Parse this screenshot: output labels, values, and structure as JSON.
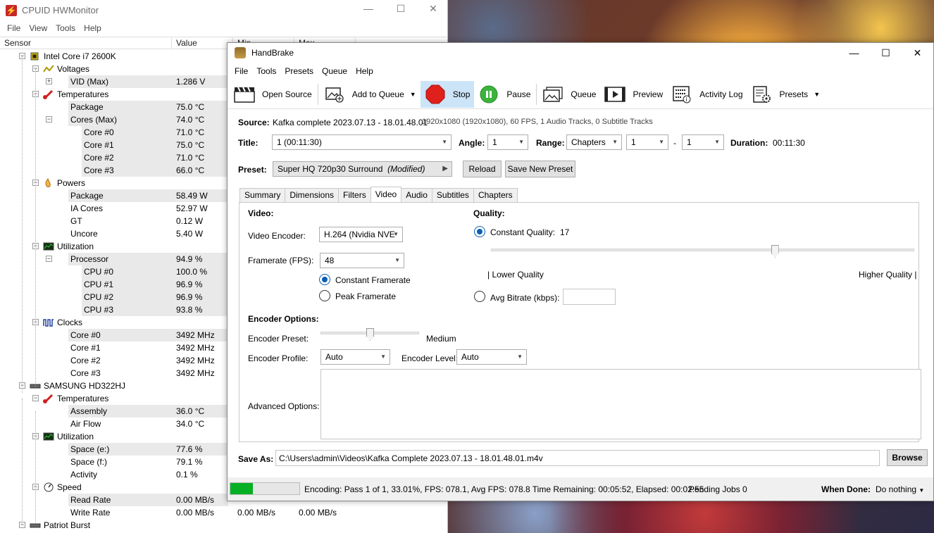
{
  "hwmonitor": {
    "title": "CPUID HWMonitor",
    "menu": [
      "File",
      "View",
      "Tools",
      "Help"
    ],
    "columns": {
      "sensor": "Sensor",
      "value": "Value",
      "min": "Min",
      "max": "Max"
    },
    "rows": [
      {
        "label": "Intel Core i7 2600K",
        "depth": 0,
        "icon": "cpu-chip-icon",
        "expander": "-"
      },
      {
        "label": "Voltages",
        "depth": 1,
        "icon": "voltage-icon",
        "expander": "-"
      },
      {
        "label": "VID (Max)",
        "depth": 2,
        "value": "1.286 V",
        "expander": "+",
        "shade": true
      },
      {
        "label": "Temperatures",
        "depth": 1,
        "icon": "thermometer-icon",
        "expander": "-"
      },
      {
        "label": "Package",
        "depth": 2,
        "value": "75.0 °C",
        "shade": true
      },
      {
        "label": "Cores (Max)",
        "depth": 2,
        "value": "74.0 °C",
        "expander": "-",
        "shade": true
      },
      {
        "label": "Core #0",
        "depth": 3,
        "value": "71.0 °C",
        "shade": true
      },
      {
        "label": "Core #1",
        "depth": 3,
        "value": "75.0 °C",
        "shade": true
      },
      {
        "label": "Core #2",
        "depth": 3,
        "value": "71.0 °C",
        "shade": true
      },
      {
        "label": "Core #3",
        "depth": 3,
        "value": "66.0 °C",
        "shade": true
      },
      {
        "label": "Powers",
        "depth": 1,
        "icon": "power-icon",
        "expander": "-"
      },
      {
        "label": "Package",
        "depth": 2,
        "value": "58.49 W",
        "shade": true
      },
      {
        "label": "IA Cores",
        "depth": 2,
        "value": "52.97 W"
      },
      {
        "label": "GT",
        "depth": 2,
        "value": "0.12 W"
      },
      {
        "label": "Uncore",
        "depth": 2,
        "value": "5.40 W"
      },
      {
        "label": "Utilization",
        "depth": 1,
        "icon": "utilization-icon",
        "expander": "-"
      },
      {
        "label": "Processor",
        "depth": 2,
        "value": "94.9 %",
        "expander": "-",
        "shade": true
      },
      {
        "label": "CPU #0",
        "depth": 3,
        "value": "100.0 %",
        "shade": true
      },
      {
        "label": "CPU #1",
        "depth": 3,
        "value": "96.9 %",
        "shade": true
      },
      {
        "label": "CPU #2",
        "depth": 3,
        "value": "96.9 %",
        "shade": true
      },
      {
        "label": "CPU #3",
        "depth": 3,
        "value": "93.8 %",
        "shade": true
      },
      {
        "label": "Clocks",
        "depth": 1,
        "icon": "clock-signal-icon",
        "expander": "-"
      },
      {
        "label": "Core #0",
        "depth": 2,
        "value": "3492 MHz",
        "shade": true
      },
      {
        "label": "Core #1",
        "depth": 2,
        "value": "3492 MHz"
      },
      {
        "label": "Core #2",
        "depth": 2,
        "value": "3492 MHz"
      },
      {
        "label": "Core #3",
        "depth": 2,
        "value": "3492 MHz"
      },
      {
        "label": "SAMSUNG HD322HJ",
        "depth": 0,
        "icon": "hard-drive-icon",
        "expander": "-"
      },
      {
        "label": "Temperatures",
        "depth": 1,
        "icon": "thermometer-icon",
        "expander": "-"
      },
      {
        "label": "Assembly",
        "depth": 2,
        "value": "36.0 °C",
        "shade": true
      },
      {
        "label": "Air Flow",
        "depth": 2,
        "value": "34.0 °C"
      },
      {
        "label": "Utilization",
        "depth": 1,
        "icon": "utilization-icon",
        "expander": "-"
      },
      {
        "label": "Space (e:)",
        "depth": 2,
        "value": "77.6 %",
        "shade": true
      },
      {
        "label": "Space (f:)",
        "depth": 2,
        "value": "79.1 %"
      },
      {
        "label": "Activity",
        "depth": 2,
        "value": "0.1 %"
      },
      {
        "label": "Speed",
        "depth": 1,
        "icon": "speed-gauge-icon",
        "expander": "-"
      },
      {
        "label": "Read Rate",
        "depth": 2,
        "value": "0.00 MB/s",
        "shade": true
      },
      {
        "label": "Write Rate",
        "depth": 2,
        "value": "0.00 MB/s",
        "min": "0.00 MB/s",
        "max": "0.00 MB/s"
      },
      {
        "label": "Patriot Burst",
        "depth": 0,
        "icon": "hard-drive-icon",
        "expander": "-"
      }
    ]
  },
  "handbrake": {
    "title": "HandBrake",
    "menu": [
      "File",
      "Tools",
      "Presets",
      "Queue",
      "Help"
    ],
    "toolbar": {
      "open_source": "Open Source",
      "add_to_queue": "Add to Queue",
      "stop": "Stop",
      "pause": "Pause",
      "queue": "Queue",
      "preview": "Preview",
      "activity_log": "Activity Log",
      "presets": "Presets"
    },
    "source": {
      "label": "Source:",
      "name": "Kafka complete 2023.07.13 - 18.01.48.01",
      "info": "1920x1080 (1920x1080), 60 FPS, 1 Audio Tracks, 0 Subtitle Tracks"
    },
    "title_row": {
      "title_label": "Title:",
      "title_value": "1  (00:11:30)",
      "angle_label": "Angle:",
      "angle_value": "1",
      "range_label": "Range:",
      "range_type": "Chapters",
      "range_start": "1",
      "range_sep": "-",
      "range_end": "1",
      "duration_label": "Duration:",
      "duration_value": "00:11:30"
    },
    "preset": {
      "label": "Preset:",
      "name": "Super HQ 720p30 Surround",
      "modified": "(Modified)",
      "reload": "Reload",
      "save_new": "Save New Preset"
    },
    "tabs": [
      "Summary",
      "Dimensions",
      "Filters",
      "Video",
      "Audio",
      "Subtitles",
      "Chapters"
    ],
    "selected_tab": "Video",
    "video": {
      "section": "Video:",
      "encoder_label": "Video Encoder:",
      "encoder_value": "H.264 (Nvidia NVE",
      "framerate_label": "Framerate (FPS):",
      "framerate_value": "48",
      "constant_framerate": "Constant Framerate",
      "peak_framerate": "Peak Framerate",
      "framerate_mode": "constant"
    },
    "quality": {
      "section": "Quality:",
      "constant_quality_label": "Constant Quality:",
      "constant_quality_value": "17",
      "slider_fraction": 0.67,
      "lower": "| Lower Quality",
      "higher": "Higher Quality |",
      "avg_bitrate_label": "Avg Bitrate (kbps):",
      "avg_bitrate_value": "",
      "mode": "constant_quality"
    },
    "encoder_options": {
      "section": "Encoder Options:",
      "preset_label": "Encoder Preset:",
      "preset_value": "Medium",
      "preset_slider_fraction": 0.5,
      "profile_label": "Encoder Profile:",
      "profile_value": "Auto",
      "level_label": "Encoder Level:",
      "level_value": "Auto",
      "advanced_label": "Advanced Options:",
      "advanced_value": ""
    },
    "save_as": {
      "label": "Save As:",
      "path": "C:\\Users\\admin\\Videos\\Kafka Complete 2023.07.13 - 18.01.48.01.m4v",
      "browse": "Browse"
    },
    "status": {
      "progress_percent": 33.01,
      "text": "Encoding: Pass 1 of 1,  33.01%, FPS: 078.1,  Avg FPS: 078.8 Time Remaining: 00:05:52,  Elapsed: 00:02:55",
      "pending": "Pending Jobs 0",
      "when_done_label": "When Done:",
      "when_done_value": "Do nothing"
    },
    "colors": {
      "accent": "#0a5fb4",
      "progress": "#06b025",
      "stop": "#e0201b",
      "pause": "#3cb43c",
      "active_tool": "#cce4f7"
    }
  }
}
